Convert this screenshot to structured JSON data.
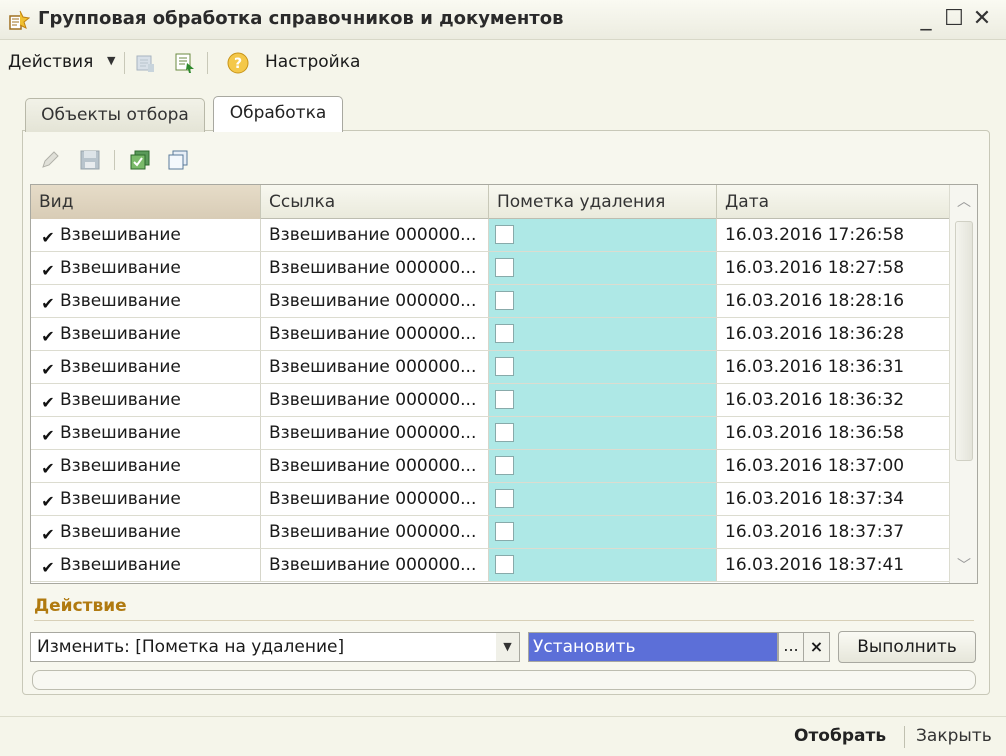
{
  "window": {
    "title": "Групповая обработка справочников и документов",
    "min": "_",
    "max": "☐",
    "close": "✕"
  },
  "toolbar": {
    "actions_label": "Действия",
    "settings_label": "Настройка"
  },
  "tabs": [
    {
      "label": "Объекты отбора",
      "active": false
    },
    {
      "label": "Обработка",
      "active": true
    }
  ],
  "table": {
    "columns": [
      "Вид",
      "Ссылка",
      "Пометка удаления",
      "Дата"
    ],
    "rows": [
      {
        "vid": "Взвешивание",
        "link": "Взвешивание 000000...",
        "date": "16.03.2016 17:26:58"
      },
      {
        "vid": "Взвешивание",
        "link": "Взвешивание 000000...",
        "date": "16.03.2016 18:27:58"
      },
      {
        "vid": "Взвешивание",
        "link": "Взвешивание 000000...",
        "date": "16.03.2016 18:28:16"
      },
      {
        "vid": "Взвешивание",
        "link": "Взвешивание 000000...",
        "date": "16.03.2016 18:36:28"
      },
      {
        "vid": "Взвешивание",
        "link": "Взвешивание 000000...",
        "date": "16.03.2016 18:36:31"
      },
      {
        "vid": "Взвешивание",
        "link": "Взвешивание 000000...",
        "date": "16.03.2016 18:36:32"
      },
      {
        "vid": "Взвешивание",
        "link": "Взвешивание 000000...",
        "date": "16.03.2016 18:36:58"
      },
      {
        "vid": "Взвешивание",
        "link": "Взвешивание 000000...",
        "date": "16.03.2016 18:37:00"
      },
      {
        "vid": "Взвешивание",
        "link": "Взвешивание 000000...",
        "date": "16.03.2016 18:37:34"
      },
      {
        "vid": "Взвешивание",
        "link": "Взвешивание 000000...",
        "date": "16.03.2016 18:37:37"
      },
      {
        "vid": "Взвешивание",
        "link": "Взвешивание 000000...",
        "date": "16.03.2016 18:37:41"
      }
    ]
  },
  "action": {
    "section_label": "Действие",
    "mode_value": "Изменить: [Пометка на удаление]",
    "target_value": "Установить",
    "dots_label": "...",
    "clear_label": "×",
    "run_label": "Выполнить"
  },
  "footer": {
    "select_label": "Отобрать",
    "close_label": "Закрыть"
  },
  "colors": {
    "mark_column": "#aee8e6",
    "selected_value": "#5c6fd8",
    "section_label": "#b07a10"
  },
  "icons": {
    "app": "app-document-icon",
    "toolbar": [
      "post-icon",
      "select-icon",
      "help-icon"
    ],
    "grid": [
      "edit-icon",
      "save-icon",
      "check-all-icon",
      "uncheck-all-icon"
    ]
  }
}
